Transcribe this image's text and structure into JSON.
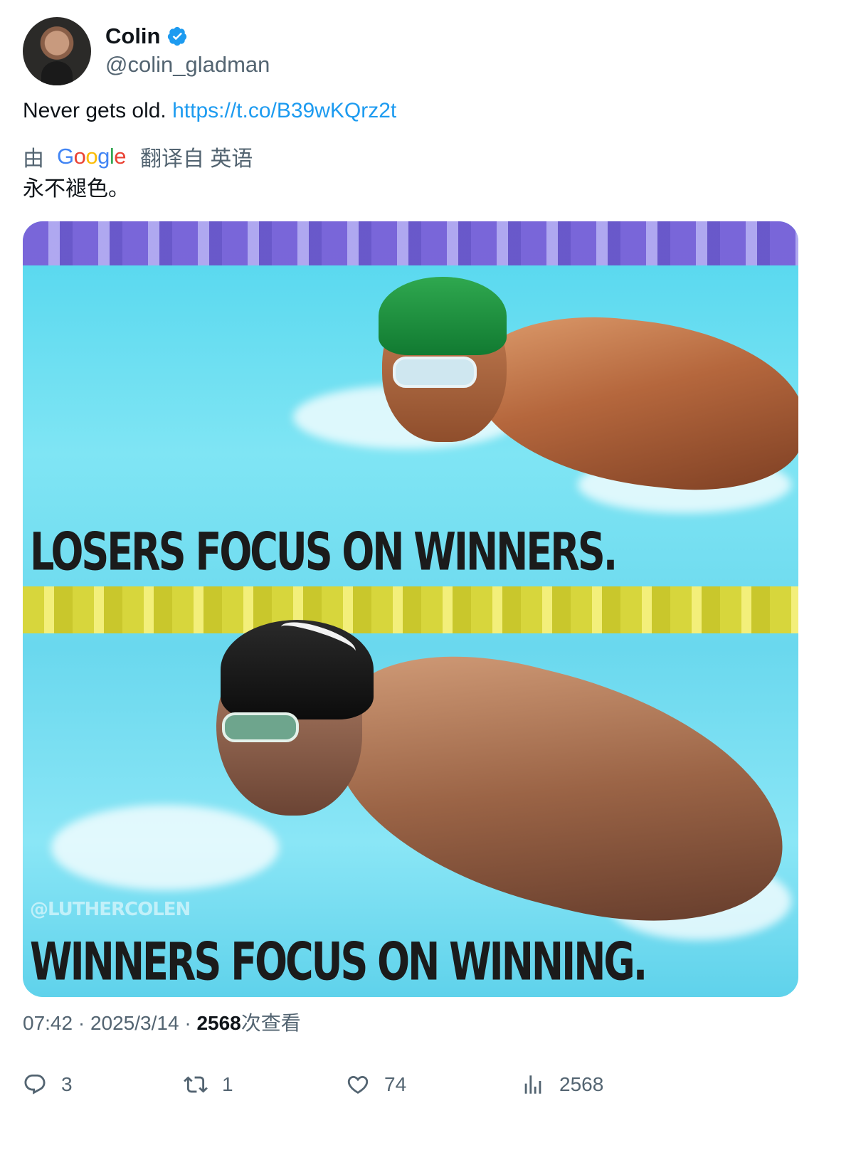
{
  "author": {
    "display_name": "Colin",
    "handle": "@colin_gladman",
    "verified": true
  },
  "tweet": {
    "text": "Never gets old. ",
    "link": "https://t.co/B39wKQrz2t"
  },
  "translation": {
    "prefix": "由",
    "provider": "Google",
    "suffix": "翻译自 英语",
    "text": "永不褪色。"
  },
  "media": {
    "caption_top": "LOSERS FOCUS ON WINNERS.",
    "caption_bottom": "WINNERS FOCUS ON WINNING.",
    "watermark": "@LUTHERCOLEN"
  },
  "meta": {
    "time": "07:42",
    "date": "2025/3/14",
    "views": "2568",
    "views_label": "次查看"
  },
  "actions": {
    "replies": "3",
    "retweets": "1",
    "likes": "74",
    "views": "2568"
  },
  "colors": {
    "link": "#1d9bf0",
    "secondary_text": "#536471",
    "verified": "#1d9bf0"
  }
}
